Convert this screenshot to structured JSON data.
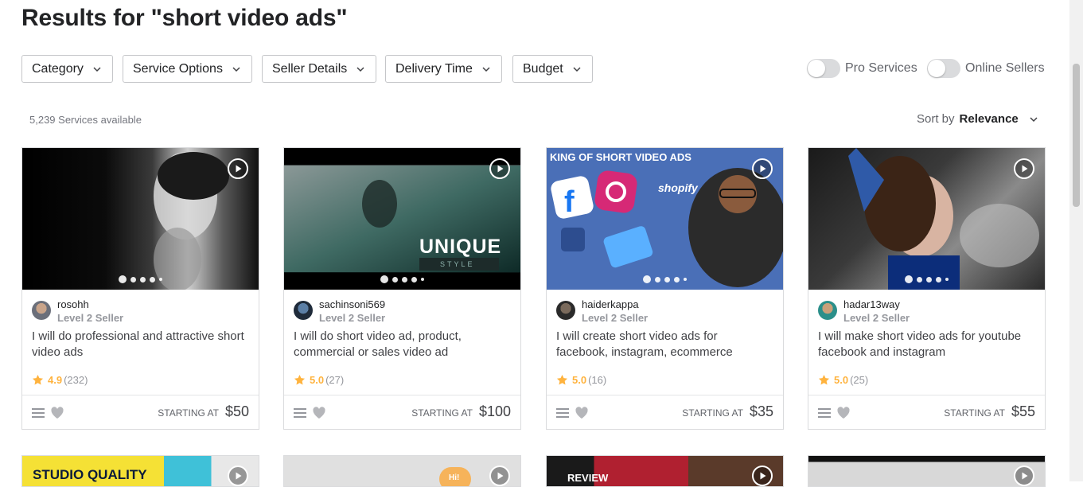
{
  "page_title": "Results for \"short video ads\"",
  "filters": [
    "Category",
    "Service Options",
    "Seller Details",
    "Delivery Time",
    "Budget"
  ],
  "toggles": {
    "pro": "Pro Services",
    "online": "Online Sellers"
  },
  "services_count": "5,239 Services available",
  "sort": {
    "label": "Sort by",
    "value": "Relevance"
  },
  "starting_label": "STARTING AT",
  "gigs": [
    {
      "seller": "rosohh",
      "level": "Level 2 Seller",
      "title": "I will do professional and attractive short video ads",
      "rating": "4.9",
      "reviews": "(232)",
      "price": "$50"
    },
    {
      "seller": "sachinsoni569",
      "level": "Level 2 Seller",
      "title": "I will do short video ad, product, commercial or sales video ad",
      "rating": "5.0",
      "reviews": "(27)",
      "price": "$100",
      "overlay": "UNIQUE",
      "overlay_sub": "STYLE"
    },
    {
      "seller": "haiderkappa",
      "level": "Level 2 Seller",
      "title": "I will create short video ads for facebook, instagram, ecommerce",
      "rating": "5.0",
      "reviews": "(16)",
      "price": "$35",
      "overlay": "KING OF SHORT VIDEO ADS",
      "overlay_sub": "shopify"
    },
    {
      "seller": "hadar13way",
      "level": "Level 2 Seller",
      "title": "I will make short video ads for youtube facebook and instagram",
      "rating": "5.0",
      "reviews": "(25)",
      "price": "$55"
    }
  ],
  "next_row": [
    "STUDIO QUALITY",
    "Hi!",
    "REVIEW"
  ]
}
